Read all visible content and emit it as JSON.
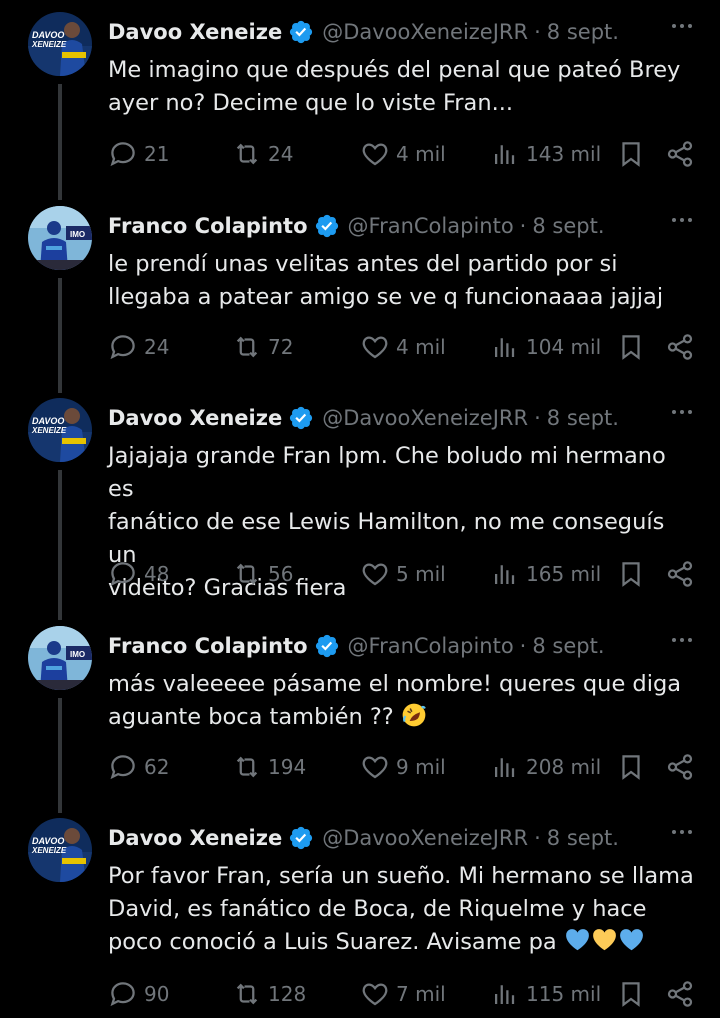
{
  "tweets": [
    {
      "name": "Davoo Xeneize",
      "handle": "@DavooXeneizeJRR",
      "time": "8 sept.",
      "avatar": "davoo",
      "lines": [
        "Me imagino que después del penal que pateó Brey",
        "ayer no? Decime que lo viste Fran..."
      ],
      "emojis": [],
      "replies": "21",
      "retweets": "24",
      "likes": "4 mil",
      "views": "143 mil"
    },
    {
      "name": "Franco Colapinto",
      "handle": "@FranColapinto",
      "time": "8 sept.",
      "avatar": "franco",
      "lines": [
        "le prendí unas velitas antes del partido por si",
        "llegaba a patear amigo se ve q funcionaaaa jajjaj"
      ],
      "emojis": [],
      "replies": "24",
      "retweets": "72",
      "likes": "4 mil",
      "views": "104 mil"
    },
    {
      "name": "Davoo Xeneize",
      "handle": "@DavooXeneizeJRR",
      "time": "8 sept.",
      "avatar": "davoo",
      "lines": [
        "Jajajaja grande Fran lpm. Che boludo mi hermano es",
        "fanático de ese Lewis Hamilton, no me conseguís un",
        "videito? Gracias fiera"
      ],
      "emojis": [],
      "replies": "48",
      "retweets": "56",
      "likes": "5 mil",
      "views": "165 mil"
    },
    {
      "name": "Franco Colapinto",
      "handle": "@FranColapinto",
      "time": "8 sept.",
      "avatar": "franco",
      "lines": [
        "más valeeeee pásame el nombre! queres que diga",
        "aguante boca también ??"
      ],
      "emojis": [
        "rolling-on-floor-laughing-emoji"
      ],
      "replies": "62",
      "retweets": "194",
      "likes": "9 mil",
      "views": "208 mil"
    },
    {
      "name": "Davoo Xeneize",
      "handle": "@DavooXeneizeJRR",
      "time": "8 sept.",
      "avatar": "davoo",
      "lines": [
        "Por favor Fran, sería un sueño. Mi hermano se llama",
        "David, es fanático de Boca, de Riquelme y hace",
        "poco conoció a Luis Suarez. Avisame pa"
      ],
      "emojis": [
        "blue-heart-emoji",
        "yellow-heart-emoji",
        "blue-heart-emoji"
      ],
      "replies": "90",
      "retweets": "128",
      "likes": "7 mil",
      "views": "115 mil"
    }
  ],
  "avatar_text": {
    "davoo_line1": "DAVOO",
    "davoo_line2": "XENEIZE",
    "franco_sponsor": "IMO"
  },
  "colors": {
    "background": "#000000",
    "text": "#e7e9ea",
    "muted": "#71767b",
    "verified": "#1d9bf0",
    "thread_line": "#333639"
  }
}
